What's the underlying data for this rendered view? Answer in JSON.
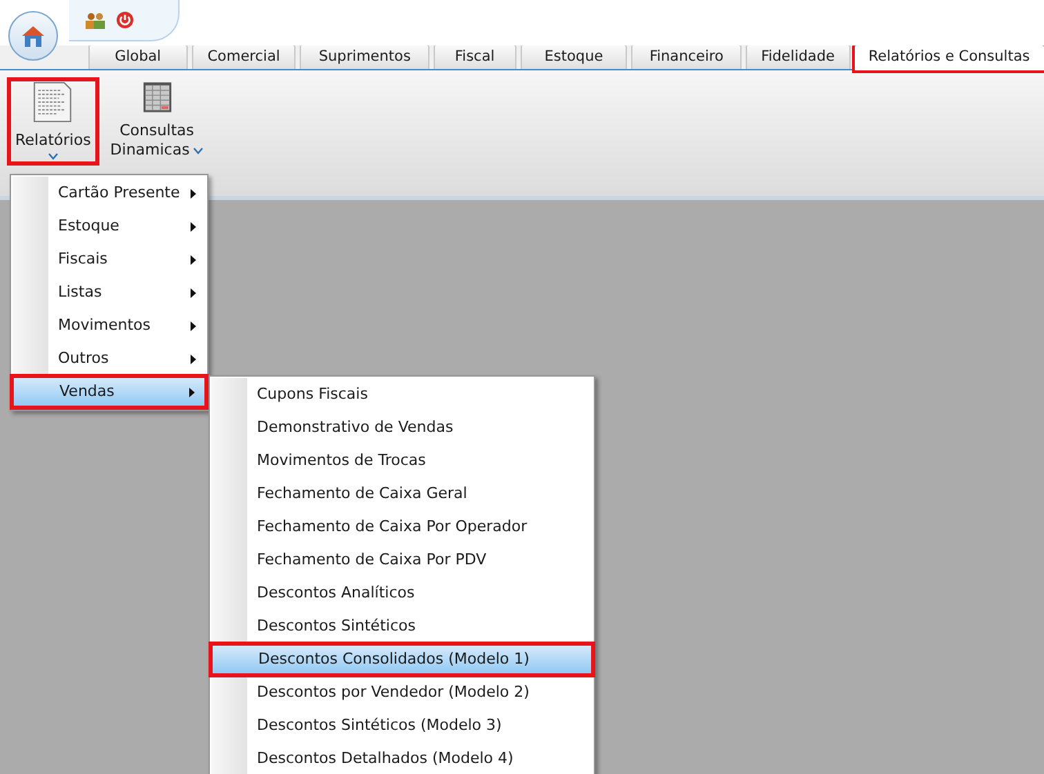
{
  "tabs": [
    {
      "label": "Global",
      "selected": false,
      "highlighted": false
    },
    {
      "label": "Comercial",
      "selected": false,
      "highlighted": false
    },
    {
      "label": "Suprimentos",
      "selected": false,
      "highlighted": false
    },
    {
      "label": "Fiscal",
      "selected": false,
      "highlighted": false
    },
    {
      "label": "Estoque",
      "selected": false,
      "highlighted": false
    },
    {
      "label": "Financeiro",
      "selected": false,
      "highlighted": false
    },
    {
      "label": "Fidelidade",
      "selected": false,
      "highlighted": false
    },
    {
      "label": "Relatórios e Consultas",
      "selected": true,
      "highlighted": true
    }
  ],
  "ribbon_buttons": [
    {
      "kind": "report",
      "lines": [
        "Relatórios"
      ],
      "highlighted": true
    },
    {
      "kind": "grid",
      "lines": [
        "Consultas",
        "Dinamicas"
      ],
      "highlighted": false
    }
  ],
  "menu": {
    "items": [
      {
        "label": "Cartão Presente",
        "selected": false,
        "highlighted": false
      },
      {
        "label": "Estoque",
        "selected": false,
        "highlighted": false
      },
      {
        "label": "Fiscais",
        "selected": false,
        "highlighted": false
      },
      {
        "label": "Listas",
        "selected": false,
        "highlighted": false
      },
      {
        "label": "Movimentos",
        "selected": false,
        "highlighted": false
      },
      {
        "label": "Outros",
        "selected": false,
        "highlighted": false
      },
      {
        "label": "Vendas",
        "selected": true,
        "highlighted": true
      }
    ]
  },
  "submenu": {
    "items": [
      {
        "label": "Cupons Fiscais",
        "selected": false,
        "highlighted": false
      },
      {
        "label": "Demonstrativo de Vendas",
        "selected": false,
        "highlighted": false
      },
      {
        "label": "Movimentos de Trocas",
        "selected": false,
        "highlighted": false
      },
      {
        "label": "Fechamento de Caixa Geral",
        "selected": false,
        "highlighted": false
      },
      {
        "label": "Fechamento de Caixa Por Operador",
        "selected": false,
        "highlighted": false
      },
      {
        "label": "Fechamento de Caixa Por PDV",
        "selected": false,
        "highlighted": false
      },
      {
        "label": "Descontos Analíticos",
        "selected": false,
        "highlighted": false
      },
      {
        "label": "Descontos Sintéticos",
        "selected": false,
        "highlighted": false
      },
      {
        "label": "Descontos Consolidados (Modelo 1)",
        "selected": true,
        "highlighted": true
      },
      {
        "label": "Descontos por Vendedor (Modelo 2)",
        "selected": false,
        "highlighted": false
      },
      {
        "label": "Descontos Sintéticos (Modelo 3)",
        "selected": false,
        "highlighted": false
      },
      {
        "label": "Descontos Detalhados (Modelo 4)",
        "selected": false,
        "highlighted": false
      }
    ]
  }
}
